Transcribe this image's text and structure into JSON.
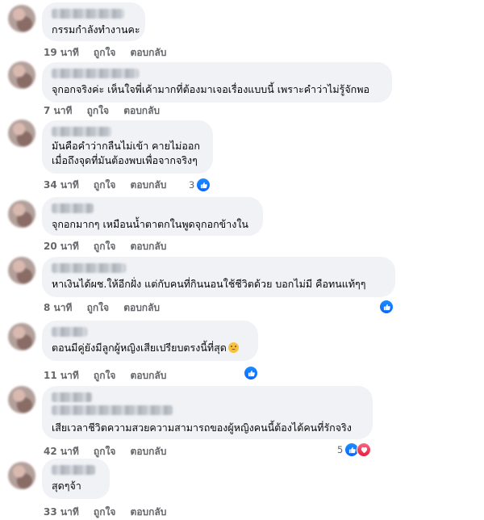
{
  "comments": [
    {
      "text": "กรรมกำลังทำงานคะ",
      "time": "19 นาที",
      "like": "ถูกใจ",
      "reply": "ตอบกลับ"
    },
    {
      "text": "จุกอกจริงค่ะ เห็นใจพี่เค้ามากที่ต้องมาเจอเรื่องแบบนี้ เพราะคำว่าไม่รู้จักพอ",
      "time": "7 นาที",
      "like": "ถูกใจ",
      "reply": "ตอบกลับ"
    },
    {
      "line1": "มันคือคำว่ากลืนไม่เข้า คายไม่ออก",
      "line2": "เมื่อถึงจุดที่มันต้องพบเพื่อจากจริงๆ",
      "time": "34 นาที",
      "like": "ถูกใจ",
      "reply": "ตอบกลับ",
      "reaction_count": "3"
    },
    {
      "text": "จุกอกมากๆ เหมือนน้ำตาตกในพูดจุกอกข้างใน",
      "time": "20 นาที",
      "like": "ถูกใจ",
      "reply": "ตอบกลับ"
    },
    {
      "text": "หาเงินได้ผช.ให้อีกฝั่ง แต่กับคนที่กินนอนใช้ชีวิตด้วย บอกไม่มี คือทนแท้ๆๆ",
      "time": "8 นาที",
      "like": "ถูกใจ",
      "reply": "ตอบกลับ"
    },
    {
      "text": "ตอนมีคู่ยังมีลูกผู้หญิงเสียเปรียบตรงนี้ที่สุด",
      "time": "11 นาที",
      "like": "ถูกใจ",
      "reply": "ตอบกลับ"
    },
    {
      "text": "เสียเวลาชีวิตความสวยความสามารถของผู้หญิงคนนี้ต้องได้คนที่รักจริง",
      "time": "42 นาที",
      "like": "ถูกใจ",
      "reply": "ตอบกลับ",
      "reaction_count": "5"
    },
    {
      "text": "สุดๆจ้า",
      "time": "33 นาที",
      "like": "ถูกใจ",
      "reply": "ตอบกลับ"
    }
  ],
  "colors": {
    "bubble": "#f0f2f5",
    "meta": "#65676b",
    "like": "#0866ff",
    "love": "#e41e3f"
  },
  "icons": [
    "like-icon",
    "love-icon",
    "sad-emoji-icon"
  ]
}
